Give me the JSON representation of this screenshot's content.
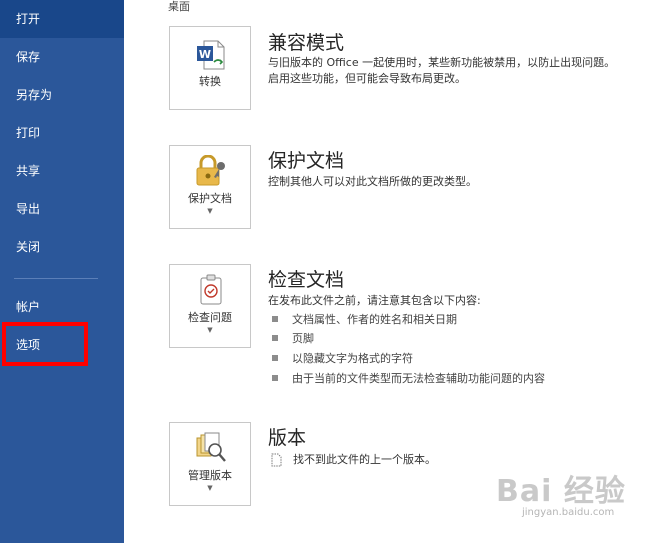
{
  "sidebar": {
    "items": [
      {
        "label": "打开"
      },
      {
        "label": "保存"
      },
      {
        "label": "另存为"
      },
      {
        "label": "打印"
      },
      {
        "label": "共享"
      },
      {
        "label": "导出"
      },
      {
        "label": "关闭"
      },
      {
        "label": "帐户"
      },
      {
        "label": "选项"
      }
    ]
  },
  "main": {
    "top_label": "桌面",
    "compat": {
      "tile_label": "转换",
      "title": "兼容模式",
      "desc_line1": "与旧版本的 Office 一起使用时，某些新功能被禁用，以防止出现问题。",
      "desc_line2": "启用这些功能，但可能会导致布局更改。"
    },
    "protect": {
      "tile_label": "保护文档",
      "title": "保护文档",
      "desc": "控制其他人可以对此文档所做的更改类型。"
    },
    "inspect": {
      "tile_label": "检查问题",
      "title": "检查文档",
      "desc": "在发布此文件之前，请注意其包含以下内容:",
      "bullets": [
        "文档属性、作者的姓名和相关日期",
        "页脚",
        "以隐藏文字为格式的字符",
        "由于当前的文件类型而无法检查辅助功能问题的内容"
      ]
    },
    "versions": {
      "tile_label": "管理版本",
      "title": "版本",
      "desc": "找不到此文件的上一个版本。"
    }
  },
  "watermark": {
    "text": "Bai 经验",
    "sub": "jingyan.baidu.com"
  },
  "colors": {
    "sidebar": "#2b579a",
    "highlight": "#ff0000"
  }
}
